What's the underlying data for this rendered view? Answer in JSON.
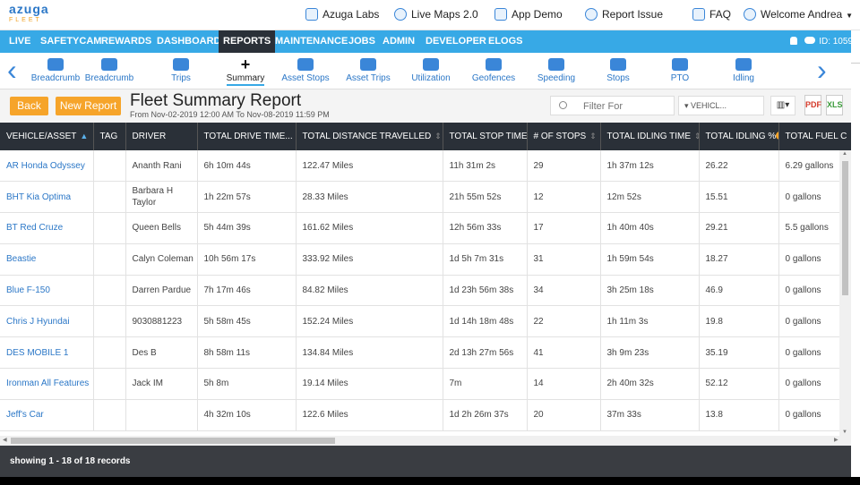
{
  "brand": {
    "name": "azuga",
    "sub": "FLEET"
  },
  "top_links": [
    {
      "label": "Azuga Labs",
      "icon": "flask-icon"
    },
    {
      "label": "Live Maps 2.0",
      "icon": "map-pin-icon"
    },
    {
      "label": "App Demo",
      "icon": "phone-icon"
    },
    {
      "label": "Report Issue",
      "icon": "bug-icon"
    },
    {
      "label": "FAQ",
      "icon": "document-icon"
    },
    {
      "label": "Welcome Andrea",
      "icon": "user-icon"
    }
  ],
  "nav": {
    "items": [
      "LIVE",
      "SAFETYCAM",
      "REWARDS",
      "DASHBOARD",
      "REPORTS",
      "MAINTENANCE",
      "JOBS",
      "ADMIN",
      "DEVELOPER",
      "ELOGS"
    ],
    "active": "REPORTS",
    "id_label": "ID: 1059"
  },
  "strip": {
    "items": [
      {
        "label": "Breadcrumb",
        "icon": "chat-pin-icon"
      },
      {
        "label": "Breadcrumb",
        "icon": "people-pin-icon"
      },
      {
        "label": "Trips",
        "icon": "route-icon"
      },
      {
        "label": "Summary",
        "icon": "plus-icon"
      },
      {
        "label": "Asset Stops",
        "icon": "trailer-stop-icon"
      },
      {
        "label": "Asset Trips",
        "icon": "trailer-trip-icon"
      },
      {
        "label": "Utilization",
        "icon": "forklift-icon"
      },
      {
        "label": "Geofences",
        "icon": "fence-icon"
      },
      {
        "label": "Speeding",
        "icon": "speeding-car-icon"
      },
      {
        "label": "Stops",
        "icon": "stop-sign-icon"
      },
      {
        "label": "PTO",
        "icon": "truck-icon"
      },
      {
        "label": "Idling",
        "icon": "idle-car-icon"
      }
    ],
    "active": "Summary"
  },
  "header": {
    "back": "Back",
    "new_report": "New Report",
    "title": "Fleet Summary Report",
    "subtitle": "From Nov-02-2019 12:00 AM  To Nov-08-2019 11:59 PM",
    "filter_placeholder": "Filter For",
    "vehicle_select": "VEHICL...",
    "pdf_label": "PDF",
    "xls_label": "XLS"
  },
  "table": {
    "columns": [
      "VEHICLE/ASSET",
      "TAG",
      "DRIVER",
      "TOTAL DRIVE TIME...",
      "TOTAL DISTANCE TRAVELLED",
      "TOTAL STOP TIME",
      "# OF STOPS",
      "TOTAL IDLING TIME",
      "TOTAL IDLING %",
      "TOTAL FUEL C"
    ],
    "rows": [
      [
        "AR Honda Odyssey",
        "",
        "Ananth Rani",
        "6h 10m 44s",
        "122.47 Miles",
        "11h 31m 2s",
        "29",
        "1h 37m 12s",
        "26.22",
        "6.29 gallons"
      ],
      [
        "BHT Kia Optima",
        "",
        "Barbara H Taylor",
        "1h 22m 57s",
        "28.33 Miles",
        "21h 55m 52s",
        "12",
        "12m 52s",
        "15.51",
        "0 gallons"
      ],
      [
        "BT Red Cruze",
        "",
        "Queen Bells",
        "5h 44m 39s",
        "161.62 Miles",
        "12h 56m 33s",
        "17",
        "1h 40m 40s",
        "29.21",
        "5.5 gallons"
      ],
      [
        "Beastie",
        "",
        "Calyn Coleman",
        "10h 56m 17s",
        "333.92 Miles",
        "1d 5h 7m 31s",
        "31",
        "1h 59m 54s",
        "18.27",
        "0 gallons"
      ],
      [
        "Blue F-150",
        "",
        "Darren Pardue",
        "7h 17m 46s",
        "84.82 Miles",
        "1d 23h 56m 38s",
        "34",
        "3h 25m 18s",
        "46.9",
        "0 gallons"
      ],
      [
        "Chris J Hyundai",
        "",
        "9030881223",
        "5h 58m 45s",
        "152.24 Miles",
        "1d 14h 18m 48s",
        "22",
        "1h 11m 3s",
        "19.8",
        "0 gallons"
      ],
      [
        "DES MOBILE 1",
        "",
        "Des B",
        "8h 58m 11s",
        "134.84 Miles",
        "2d 13h 27m 56s",
        "41",
        "3h 9m 23s",
        "35.19",
        "0 gallons"
      ],
      [
        "Ironman All Features",
        "",
        "Jack IM",
        "5h 8m",
        "19.14 Miles",
        "7m",
        "14",
        "2h 40m 32s",
        "52.12",
        "0 gallons"
      ],
      [
        "Jeff's Car",
        "",
        "",
        "4h 32m 10s",
        "122.6 Miles",
        "1d 2h 26m 37s",
        "20",
        "37m 33s",
        "13.8",
        "0 gallons"
      ]
    ]
  },
  "footer": {
    "records": "showing 1 - 18 of 18 records"
  }
}
